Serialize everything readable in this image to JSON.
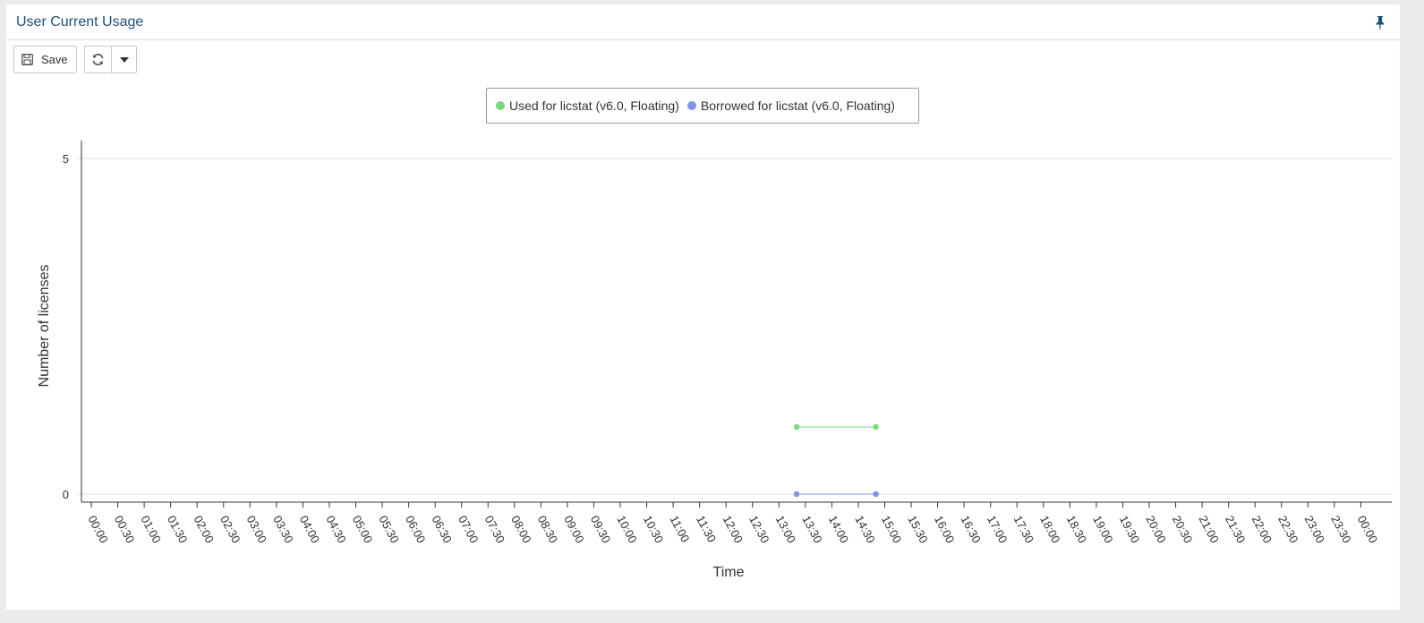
{
  "panel": {
    "title": "User Current Usage"
  },
  "toolbar": {
    "save_label": "Save",
    "save_icon": "floppy-disk-icon",
    "refresh_icon": "refresh-icon",
    "caret_icon": "caret-down-icon",
    "pin_icon": "pin-icon"
  },
  "legend": {
    "items": [
      {
        "label": "Used for licstat (v6.0, Floating)",
        "color": "#7fd67f"
      },
      {
        "label": "Borrowed for licstat (v6.0, Floating)",
        "color": "#7d93e6"
      }
    ]
  },
  "chart_data": {
    "type": "line",
    "xlabel": "Time",
    "ylabel": "Number of licenses",
    "x_ticks": [
      "00:00",
      "00:30",
      "01:00",
      "01:30",
      "02:00",
      "02:30",
      "03:00",
      "03:30",
      "04:00",
      "04:30",
      "05:00",
      "05:30",
      "06:00",
      "06:30",
      "07:00",
      "07:30",
      "08:00",
      "08:30",
      "09:00",
      "09:30",
      "10:00",
      "10:30",
      "11:00",
      "11:30",
      "12:00",
      "12:30",
      "13:00",
      "13:30",
      "14:00",
      "14:30",
      "15:00",
      "15:30",
      "16:00",
      "16:30",
      "17:00",
      "17:30",
      "18:00",
      "18:30",
      "19:00",
      "19:30",
      "20:00",
      "20:30",
      "21:00",
      "21:30",
      "22:00",
      "22:30",
      "23:00",
      "23:30",
      "00:00"
    ],
    "y_ticks": [
      0,
      5
    ],
    "ylim": [
      0,
      5
    ],
    "grid": "horizontal",
    "legend_position": "top-center",
    "series": [
      {
        "name": "Used for licstat (v6.0, Floating)",
        "color": "#7fd67f",
        "x": [
          "13:20",
          "14:50"
        ],
        "y": [
          1,
          1
        ]
      },
      {
        "name": "Borrowed for licstat (v6.0, Floating)",
        "color": "#7d93e6",
        "x": [
          "13:20",
          "14:50"
        ],
        "y": [
          0,
          0
        ]
      }
    ]
  }
}
